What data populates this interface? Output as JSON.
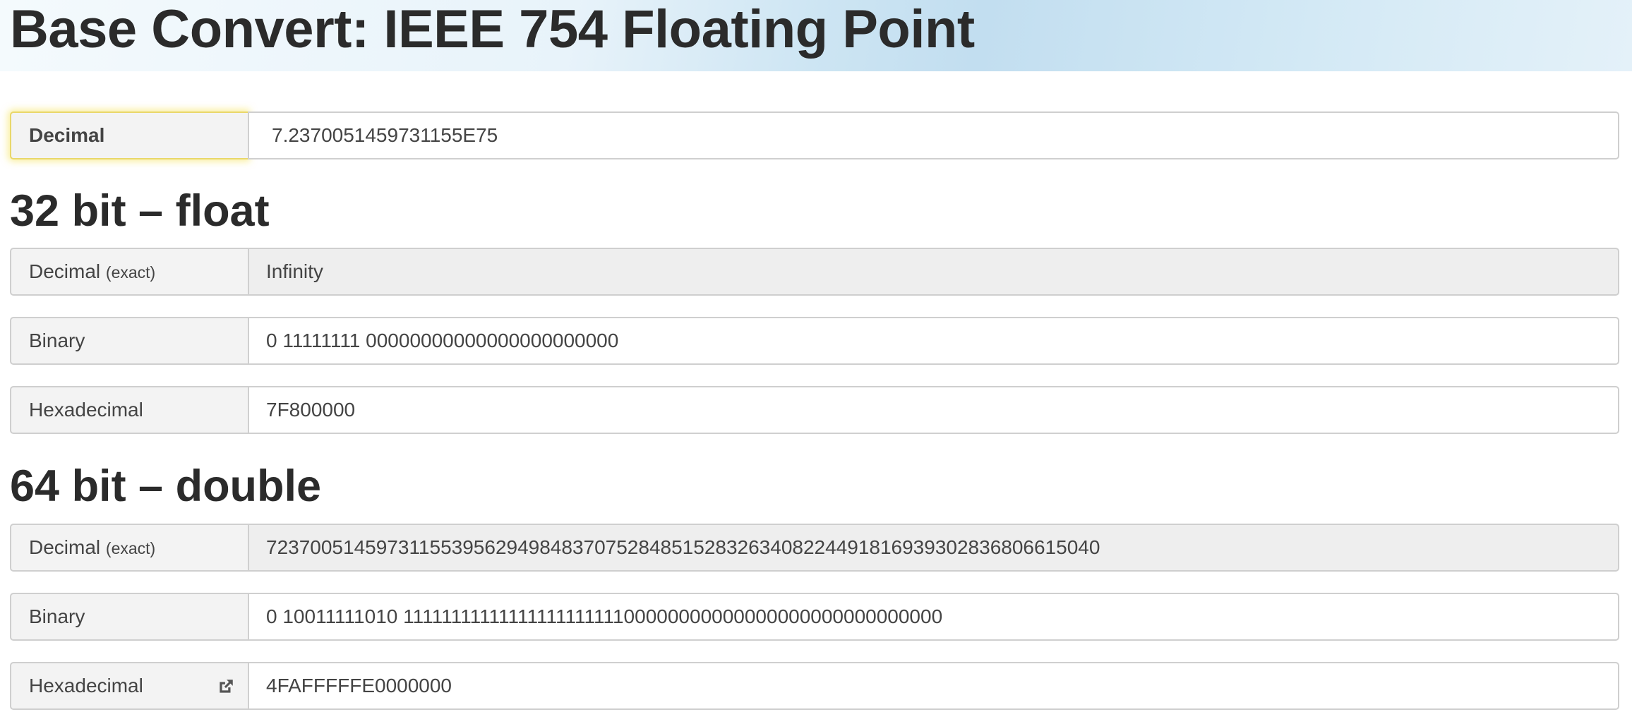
{
  "page": {
    "title": "Base Convert: IEEE 754 Floating Point"
  },
  "input": {
    "label": "Decimal",
    "value": "7.2370051459731155E75"
  },
  "float32": {
    "heading": "32 bit – float",
    "decimal_label": "Decimal",
    "decimal_label_note": "(exact)",
    "decimal_value": "Infinity",
    "binary_label": "Binary",
    "binary_value": "0 11111111 00000000000000000000000",
    "hex_label": "Hexadecimal",
    "hex_value": "7F800000"
  },
  "float64": {
    "heading": "64 bit – double",
    "decimal_label": "Decimal",
    "decimal_label_note": "(exact)",
    "decimal_value": "7237005145973115539562949848370752848515283263408224491816939302836806615040",
    "binary_label": "Binary",
    "binary_value": "0 10011111010 1111111111111111111111100000000000000000000000000000",
    "hex_label": "Hexadecimal",
    "hex_value": "4FAFFFFFE0000000",
    "hex_icon": "external-link-icon"
  },
  "colors": {
    "label_bg": "#f3f3f3",
    "readonly_bg": "#eeeeee",
    "border": "#cfcfcf",
    "focus_glow": "#f5e150",
    "banner_accent": "#c2def0"
  }
}
